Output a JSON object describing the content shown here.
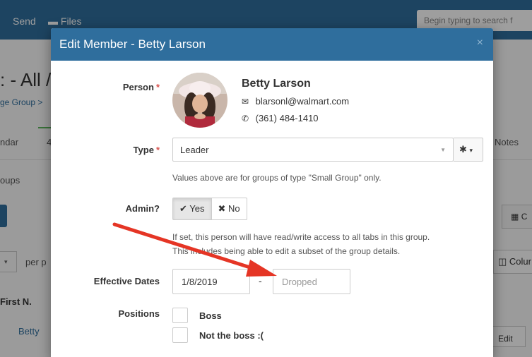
{
  "background": {
    "nav": {
      "send": "Send",
      "files": "Files",
      "search_placeholder": "Begin typing to search f"
    },
    "page_title": ": - All /",
    "breadcrumb": "ge Group >",
    "tab_calendar": "ndar",
    "tab_4": "4",
    "tab_notes": "Notes",
    "groups_label": "oups",
    "per_page": "per p",
    "first_name_header": "First N.",
    "first_row_name": "Betty",
    "btn_c": "C",
    "btn_columns": "Colur",
    "btn_edit": "Edit"
  },
  "modal": {
    "title": "Edit Member - Betty Larson",
    "close": "×",
    "person": {
      "label": "Person",
      "required": "*",
      "name": "Betty Larson",
      "email": "blarsonl@walmart.com",
      "phone": "(361) 484-1410"
    },
    "type": {
      "label": "Type",
      "required": "*",
      "value": "Leader",
      "help": "Values above are for groups of type \"Small Group\" only."
    },
    "admin": {
      "label": "Admin?",
      "yes": "Yes",
      "no": "No",
      "selected": "Yes",
      "help_line1": "If set, this person will have read/write access to all tabs in this group.",
      "help_line2": "This includes being able to edit a subset of the group details."
    },
    "effective_dates": {
      "label": "Effective Dates",
      "start": "1/8/2019",
      "separator": "-",
      "end_placeholder": "Dropped"
    },
    "positions": {
      "label": "Positions",
      "items": [
        {
          "label": "Boss",
          "checked": false
        },
        {
          "label": "Not the boss :(",
          "checked": false
        }
      ]
    }
  },
  "annotation_color": "#e53525"
}
